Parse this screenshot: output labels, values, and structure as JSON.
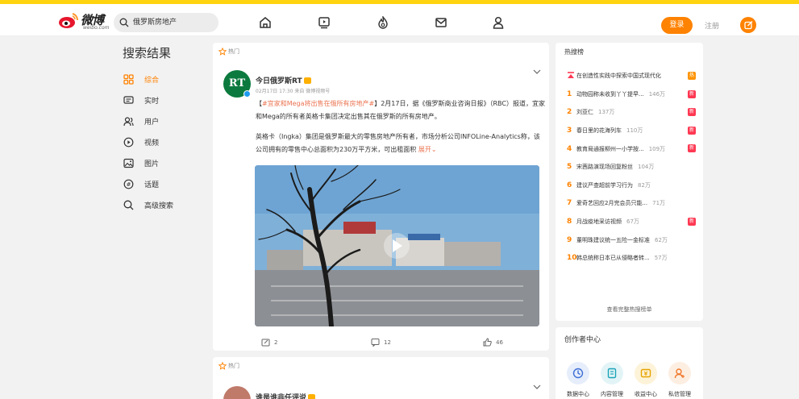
{
  "header": {
    "logo_text": "微博",
    "logo_sub": "weibo.com",
    "search_value": "俄罗斯房地产",
    "login_label": "登录",
    "register_label": "注册"
  },
  "leftnav": {
    "title": "搜索结果",
    "items": [
      {
        "label": "综合",
        "icon": "grid-icon",
        "active": true
      },
      {
        "label": "实时",
        "icon": "realtime-icon"
      },
      {
        "label": "用户",
        "icon": "users-icon"
      },
      {
        "label": "视频",
        "icon": "play-icon"
      },
      {
        "label": "图片",
        "icon": "image-icon"
      },
      {
        "label": "话题",
        "icon": "topic-icon"
      },
      {
        "label": "高级搜索",
        "icon": "search-icon"
      }
    ]
  },
  "feed": {
    "posts": [
      {
        "hot_tag": "热门",
        "avatar_text": "RT",
        "user": "今日俄罗斯RT",
        "meta": "02月17日 17:30  来自 微博视频号",
        "topic": "#宜家和Mega将出售在俄所有房地产#",
        "body1": "2月17日，据《俄罗斯商业咨询日报》（RBC）报道，宜家和Mega的所有者英格卡集团决定出售其在俄罗斯的所有房地产。",
        "body2": "英格卡（Ingka）集团是俄罗斯最大的零售房地产所有者，市场分析公司INFOLine-Analytics称，该公司拥有的零售中心总面积为230万平方米，可出租面积",
        "expand": "展开",
        "repost": "2",
        "comment": "12",
        "like": "46"
      },
      {
        "hot_tag": "热门",
        "user": "谁是谁非任评说"
      }
    ]
  },
  "hotsearch": {
    "title": "热搜榜",
    "pinned": "在创造性实践中探索中国式现代化",
    "pinned_badge": "热",
    "items": [
      {
        "rank": "1",
        "title": "动物园称未收到丫丫提早...",
        "count": "146万",
        "badge": "新"
      },
      {
        "rank": "2",
        "title": "刘亚仁",
        "count": "137万",
        "badge": "新"
      },
      {
        "rank": "3",
        "title": "春日里的花海列车",
        "count": "110万",
        "badge": "新"
      },
      {
        "rank": "4",
        "title": "教育局通报柳州一小学按...",
        "count": "109万",
        "badge": "新"
      },
      {
        "rank": "5",
        "title": "宋茜路演现场回复粉丝",
        "count": "104万",
        "badge": ""
      },
      {
        "rank": "6",
        "title": "建议严查超前学习行为",
        "count": "82万",
        "badge": ""
      },
      {
        "rank": "7",
        "title": "爱奇艺回应2月完会员只能...",
        "count": "71万",
        "badge": ""
      },
      {
        "rank": "8",
        "title": "月战疫地采访视频",
        "count": "67万",
        "badge": "新"
      },
      {
        "rank": "9",
        "title": "董明珠建议统一五险一金标准",
        "count": "62万",
        "badge": ""
      },
      {
        "rank": "10",
        "title": "韩总统称日本已从侵略者转...",
        "count": "57万",
        "badge": ""
      }
    ],
    "see_all": "查看完整热搜榜单"
  },
  "creator": {
    "title": "创作者中心",
    "items": [
      {
        "label": "数据中心",
        "icon": "data-icon",
        "color": "#e6edfb"
      },
      {
        "label": "内容管理",
        "icon": "content-icon",
        "color": "#e3f4f7"
      },
      {
        "label": "收益中心",
        "icon": "income-icon",
        "color": "#fdf3d9"
      },
      {
        "label": "私信管理",
        "icon": "message-manage-icon",
        "color": "#fdeee2"
      }
    ]
  },
  "colors": {
    "accent": "#ff8200",
    "link": "#eb7350",
    "stripe": "#ffd30f",
    "new_badge": "#ff3852"
  }
}
